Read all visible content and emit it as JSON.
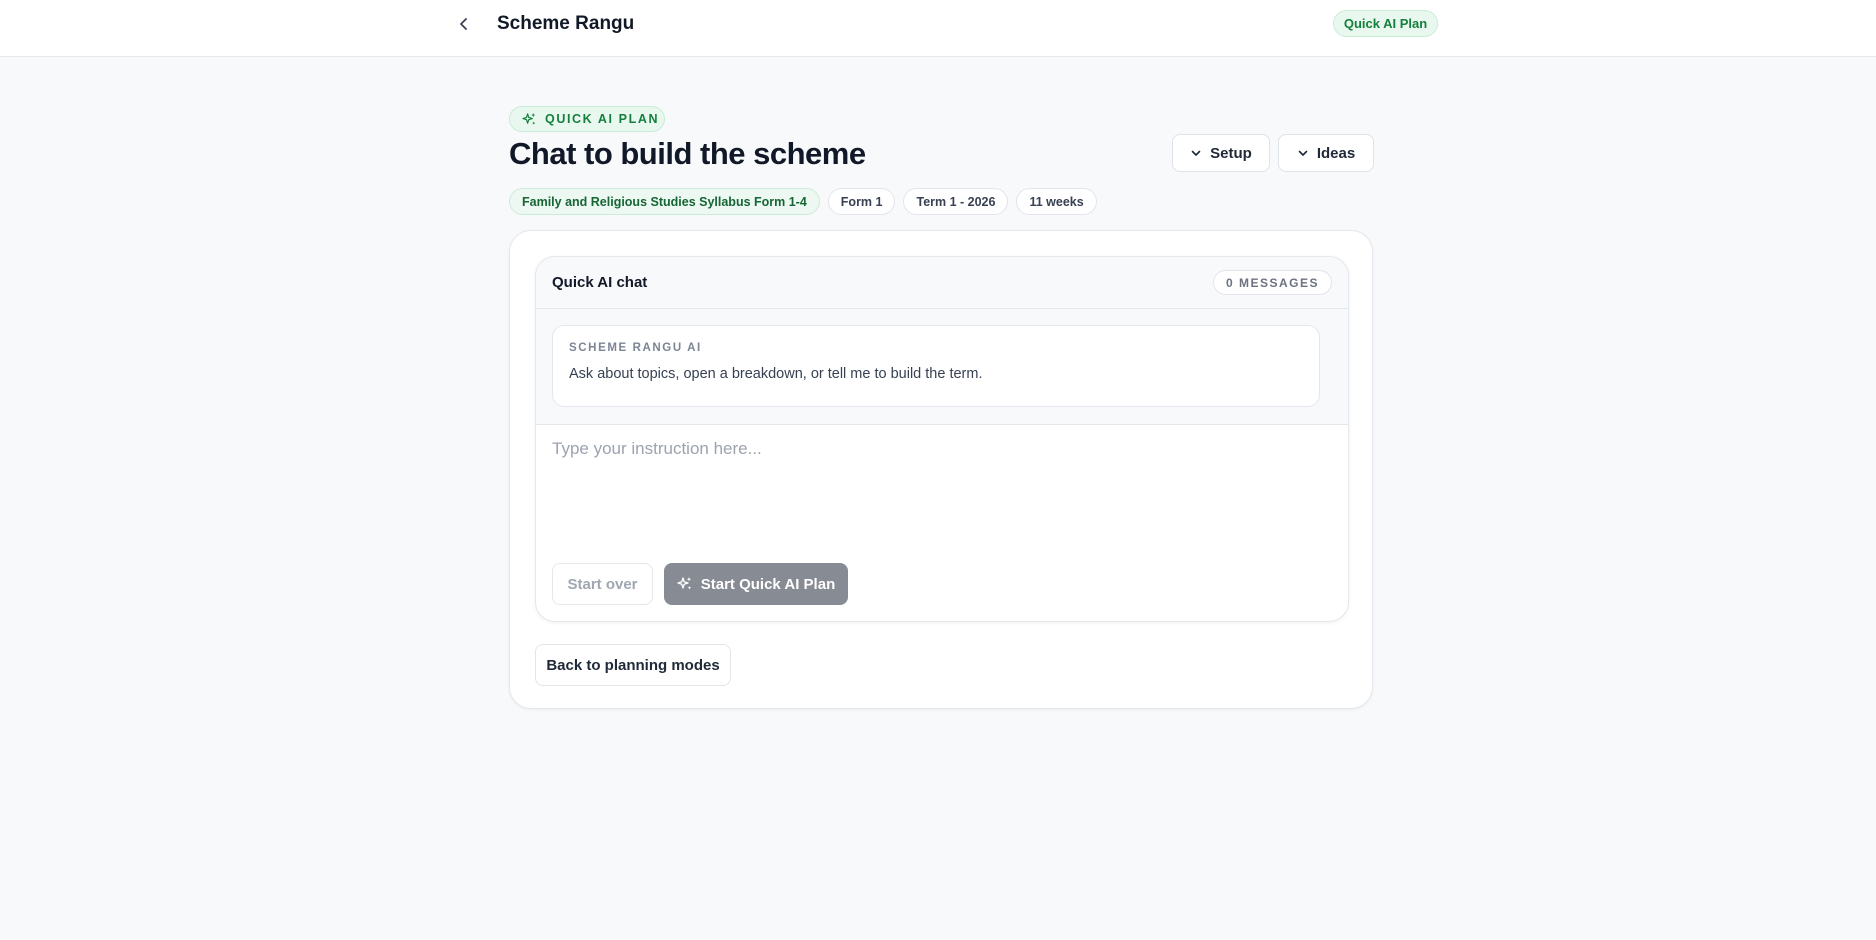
{
  "header": {
    "app_title": "Scheme Rangu",
    "mode_badge": "Quick AI Plan"
  },
  "page": {
    "eyebrow": "QUICK AI PLAN",
    "title": "Chat to build the scheme",
    "setup_label": "Setup",
    "ideas_label": "Ideas",
    "chips": [
      "Family and Religious Studies Syllabus Form 1-4",
      "Form 1",
      "Term 1 - 2026",
      "11 weeks"
    ]
  },
  "chat": {
    "title": "Quick AI chat",
    "message_count": "0 MESSAGES",
    "assistant_name": "SCHEME RANGU AI",
    "assistant_message": "Ask about topics, open a breakdown, or tell me to build the term.",
    "input_value": "",
    "input_placeholder": "Type your instruction here...",
    "start_over_label": "Start over",
    "start_plan_label": "Start Quick AI Plan"
  },
  "footer": {
    "back_label": "Back to planning modes"
  },
  "colors": {
    "accent_green": "#15803d",
    "badge_green_bg": "#e9f8ef",
    "disabled_button": "#878b93",
    "page_bg": "#f8f9fb"
  },
  "icons": {
    "back": "chevron-left-icon",
    "eyebrow": "sparkles-icon",
    "dropdown": "chevron-down-icon",
    "start": "sparkles-icon"
  }
}
